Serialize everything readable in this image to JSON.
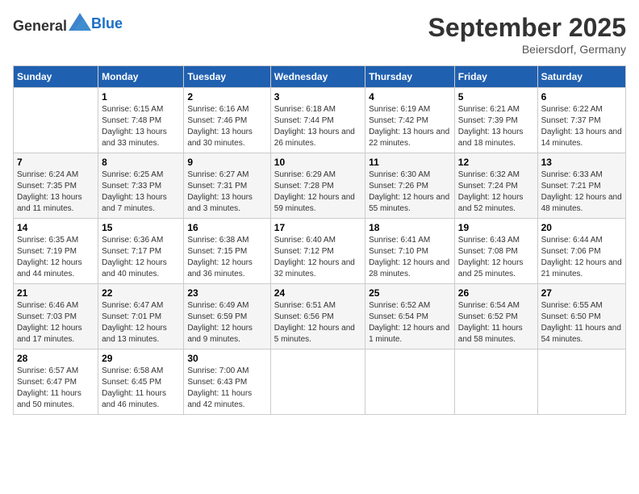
{
  "header": {
    "logo_general": "General",
    "logo_blue": "Blue",
    "title": "September 2025",
    "location": "Beiersdorf, Germany"
  },
  "days_of_week": [
    "Sunday",
    "Monday",
    "Tuesday",
    "Wednesday",
    "Thursday",
    "Friday",
    "Saturday"
  ],
  "weeks": [
    [
      {
        "day": "",
        "info": ""
      },
      {
        "day": "1",
        "info": "Sunrise: 6:15 AM\nSunset: 7:48 PM\nDaylight: 13 hours and 33 minutes."
      },
      {
        "day": "2",
        "info": "Sunrise: 6:16 AM\nSunset: 7:46 PM\nDaylight: 13 hours and 30 minutes."
      },
      {
        "day": "3",
        "info": "Sunrise: 6:18 AM\nSunset: 7:44 PM\nDaylight: 13 hours and 26 minutes."
      },
      {
        "day": "4",
        "info": "Sunrise: 6:19 AM\nSunset: 7:42 PM\nDaylight: 13 hours and 22 minutes."
      },
      {
        "day": "5",
        "info": "Sunrise: 6:21 AM\nSunset: 7:39 PM\nDaylight: 13 hours and 18 minutes."
      },
      {
        "day": "6",
        "info": "Sunrise: 6:22 AM\nSunset: 7:37 PM\nDaylight: 13 hours and 14 minutes."
      }
    ],
    [
      {
        "day": "7",
        "info": "Sunrise: 6:24 AM\nSunset: 7:35 PM\nDaylight: 13 hours and 11 minutes."
      },
      {
        "day": "8",
        "info": "Sunrise: 6:25 AM\nSunset: 7:33 PM\nDaylight: 13 hours and 7 minutes."
      },
      {
        "day": "9",
        "info": "Sunrise: 6:27 AM\nSunset: 7:31 PM\nDaylight: 13 hours and 3 minutes."
      },
      {
        "day": "10",
        "info": "Sunrise: 6:29 AM\nSunset: 7:28 PM\nDaylight: 12 hours and 59 minutes."
      },
      {
        "day": "11",
        "info": "Sunrise: 6:30 AM\nSunset: 7:26 PM\nDaylight: 12 hours and 55 minutes."
      },
      {
        "day": "12",
        "info": "Sunrise: 6:32 AM\nSunset: 7:24 PM\nDaylight: 12 hours and 52 minutes."
      },
      {
        "day": "13",
        "info": "Sunrise: 6:33 AM\nSunset: 7:21 PM\nDaylight: 12 hours and 48 minutes."
      }
    ],
    [
      {
        "day": "14",
        "info": "Sunrise: 6:35 AM\nSunset: 7:19 PM\nDaylight: 12 hours and 44 minutes."
      },
      {
        "day": "15",
        "info": "Sunrise: 6:36 AM\nSunset: 7:17 PM\nDaylight: 12 hours and 40 minutes."
      },
      {
        "day": "16",
        "info": "Sunrise: 6:38 AM\nSunset: 7:15 PM\nDaylight: 12 hours and 36 minutes."
      },
      {
        "day": "17",
        "info": "Sunrise: 6:40 AM\nSunset: 7:12 PM\nDaylight: 12 hours and 32 minutes."
      },
      {
        "day": "18",
        "info": "Sunrise: 6:41 AM\nSunset: 7:10 PM\nDaylight: 12 hours and 28 minutes."
      },
      {
        "day": "19",
        "info": "Sunrise: 6:43 AM\nSunset: 7:08 PM\nDaylight: 12 hours and 25 minutes."
      },
      {
        "day": "20",
        "info": "Sunrise: 6:44 AM\nSunset: 7:06 PM\nDaylight: 12 hours and 21 minutes."
      }
    ],
    [
      {
        "day": "21",
        "info": "Sunrise: 6:46 AM\nSunset: 7:03 PM\nDaylight: 12 hours and 17 minutes."
      },
      {
        "day": "22",
        "info": "Sunrise: 6:47 AM\nSunset: 7:01 PM\nDaylight: 12 hours and 13 minutes."
      },
      {
        "day": "23",
        "info": "Sunrise: 6:49 AM\nSunset: 6:59 PM\nDaylight: 12 hours and 9 minutes."
      },
      {
        "day": "24",
        "info": "Sunrise: 6:51 AM\nSunset: 6:56 PM\nDaylight: 12 hours and 5 minutes."
      },
      {
        "day": "25",
        "info": "Sunrise: 6:52 AM\nSunset: 6:54 PM\nDaylight: 12 hours and 1 minute."
      },
      {
        "day": "26",
        "info": "Sunrise: 6:54 AM\nSunset: 6:52 PM\nDaylight: 11 hours and 58 minutes."
      },
      {
        "day": "27",
        "info": "Sunrise: 6:55 AM\nSunset: 6:50 PM\nDaylight: 11 hours and 54 minutes."
      }
    ],
    [
      {
        "day": "28",
        "info": "Sunrise: 6:57 AM\nSunset: 6:47 PM\nDaylight: 11 hours and 50 minutes."
      },
      {
        "day": "29",
        "info": "Sunrise: 6:58 AM\nSunset: 6:45 PM\nDaylight: 11 hours and 46 minutes."
      },
      {
        "day": "30",
        "info": "Sunrise: 7:00 AM\nSunset: 6:43 PM\nDaylight: 11 hours and 42 minutes."
      },
      {
        "day": "",
        "info": ""
      },
      {
        "day": "",
        "info": ""
      },
      {
        "day": "",
        "info": ""
      },
      {
        "day": "",
        "info": ""
      }
    ]
  ]
}
